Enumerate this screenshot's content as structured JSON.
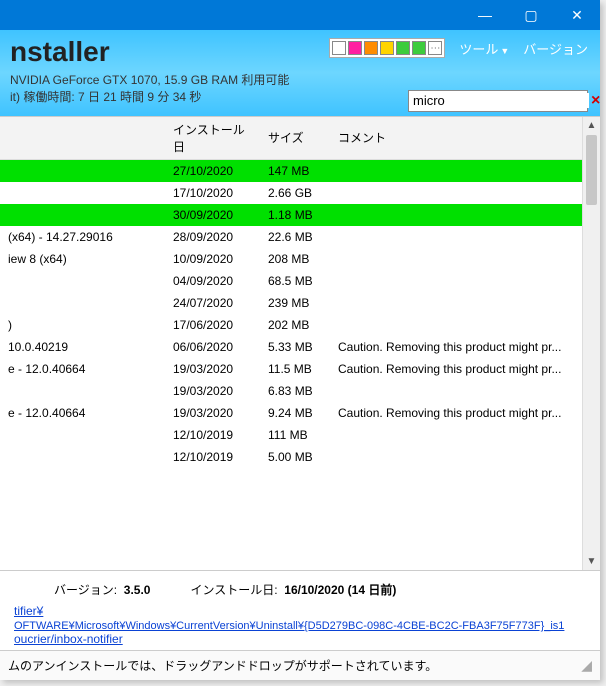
{
  "titlebar": {
    "min": "—",
    "max": "▢",
    "close": "✕"
  },
  "header": {
    "app_title": "nstaller",
    "sys_line1": "NVIDIA GeForce GTX 1070, 15.9 GB RAM 利用可能",
    "sys_line2": "it)   稼働時間: 7 日 21 時間 9 分 34 秒",
    "tool_label": "ツール",
    "version_label": "バージョン"
  },
  "search": {
    "value": "micro",
    "clear": "×"
  },
  "chips": [
    "#ffffff",
    "#ff1fa1",
    "#ff8c00",
    "#ffd400",
    "#3dcc3d",
    "#3dcc3d",
    "#c7c7c7"
  ],
  "columns": {
    "name": "",
    "date": "インストール日",
    "size": "サイズ",
    "comment": "コメント"
  },
  "rows": [
    {
      "hl": true,
      "name": "",
      "date": "27/10/2020",
      "size": "147 MB",
      "comment": ""
    },
    {
      "hl": false,
      "name": "",
      "date": "17/10/2020",
      "size": "2.66 GB",
      "comment": ""
    },
    {
      "hl": true,
      "name": "",
      "date": "30/09/2020",
      "size": "1.18 MB",
      "comment": ""
    },
    {
      "hl": false,
      "name": "(x64) - 14.27.29016",
      "date": "28/09/2020",
      "size": "22.6 MB",
      "comment": ""
    },
    {
      "hl": false,
      "name": "iew 8 (x64)",
      "date": "10/09/2020",
      "size": "208 MB",
      "comment": ""
    },
    {
      "hl": false,
      "name": "",
      "date": "04/09/2020",
      "size": "68.5 MB",
      "comment": ""
    },
    {
      "hl": false,
      "name": "",
      "date": "24/07/2020",
      "size": "239 MB",
      "comment": ""
    },
    {
      "hl": false,
      "name": ")",
      "date": "17/06/2020",
      "size": "202 MB",
      "comment": ""
    },
    {
      "hl": false,
      "name": "10.0.40219",
      "date": "06/06/2020",
      "size": "5.33 MB",
      "comment": "Caution. Removing this product might pr..."
    },
    {
      "hl": false,
      "name": "e - 12.0.40664",
      "date": "19/03/2020",
      "size": "11.5 MB",
      "comment": "Caution. Removing this product might pr..."
    },
    {
      "hl": false,
      "name": "",
      "date": "19/03/2020",
      "size": "6.83 MB",
      "comment": ""
    },
    {
      "hl": false,
      "name": "e - 12.0.40664",
      "date": "19/03/2020",
      "size": "9.24 MB",
      "comment": "Caution. Removing this product might pr..."
    },
    {
      "hl": false,
      "name": "",
      "date": "12/10/2019",
      "size": "111 MB",
      "comment": ""
    },
    {
      "hl": false,
      "name": "",
      "date": "12/10/2019",
      "size": "5.00 MB",
      "comment": ""
    }
  ],
  "detail": {
    "version_label": "バージョン:",
    "version_value": "3.5.0",
    "install_label": "インストール日:",
    "install_value": "16/10/2020 (14 日前)",
    "link1": "tifier¥",
    "regline": "OFTWARE¥Microsoft¥Windows¥CurrentVersion¥Uninstall¥{D5D279BC-098C-4CBE-BC2C-FBA3F75F773F}_is1",
    "link2": "oucrier/inbox-notifier"
  },
  "status": {
    "text": "ムのアンインストールでは、ドラッグアンドドロップがサポートされています。"
  }
}
